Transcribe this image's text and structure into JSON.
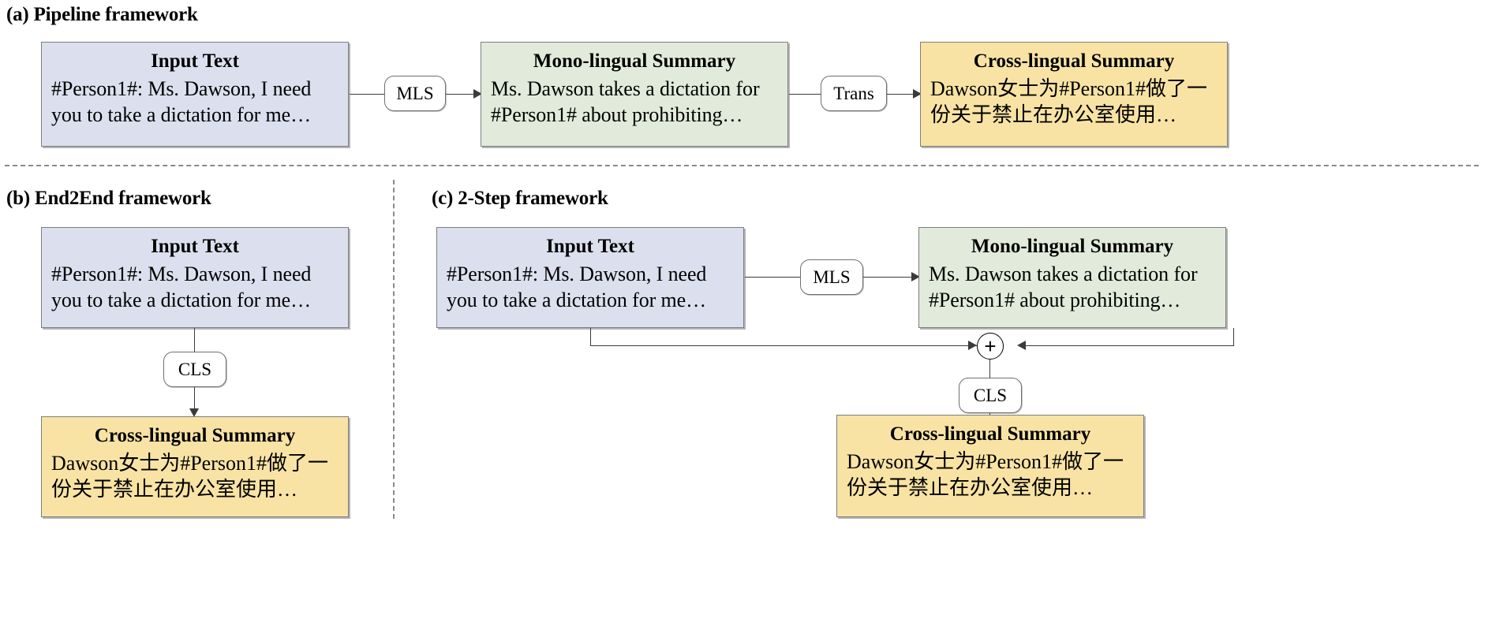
{
  "figure": {
    "panels": [
      {
        "id": "a",
        "title": "(a) Pipeline framework",
        "nodes": [
          {
            "name": "input-text",
            "title": "Input Text",
            "body": "#Person1#: Ms. Dawson, I need you to take a dictation for me…"
          },
          {
            "name": "mono-summary",
            "title": "Mono-lingual Summary",
            "body": "Ms. Dawson takes a dictation for #Person1# about prohibiting…"
          },
          {
            "name": "cross-summary",
            "title": "Cross-lingual Summary",
            "body": "Dawson女士为#Person1#做了一份关于禁止在办公室使用…"
          }
        ],
        "operators": [
          {
            "name": "mls",
            "label": "MLS"
          },
          {
            "name": "trans",
            "label": "Trans"
          }
        ]
      },
      {
        "id": "b",
        "title": "(b) End2End framework",
        "nodes": [
          {
            "name": "input-text",
            "title": "Input Text",
            "body": "#Person1#: Ms. Dawson, I need you to take a dictation for me…"
          },
          {
            "name": "cross-summary",
            "title": "Cross-lingual Summary",
            "body": "Dawson女士为#Person1#做了一份关于禁止在办公室使用…"
          }
        ],
        "operators": [
          {
            "name": "cls",
            "label": "CLS"
          }
        ]
      },
      {
        "id": "c",
        "title": "(c) 2-Step framework",
        "nodes": [
          {
            "name": "input-text",
            "title": "Input Text",
            "body": "#Person1#: Ms. Dawson, I need you to take a dictation for me…"
          },
          {
            "name": "mono-summary",
            "title": "Mono-lingual Summary",
            "body": "Ms. Dawson takes a dictation for #Person1# about prohibiting…"
          },
          {
            "name": "cross-summary",
            "title": "Cross-lingual Summary",
            "body": "Dawson女士为#Person1#做了一份关于禁止在办公室使用…"
          }
        ],
        "operators": [
          {
            "name": "mls",
            "label": "MLS"
          },
          {
            "name": "cls",
            "label": "CLS"
          }
        ],
        "junction": {
          "name": "plus-junction",
          "label": "+"
        }
      }
    ],
    "colors": {
      "input_fill": "#dce0ee",
      "mono_fill": "#e2ebdb",
      "cross_fill": "#f8e3a4",
      "box_border": "#7d7d7d",
      "connector": "#3b3b3b",
      "divider": "#8a8a8a"
    }
  }
}
